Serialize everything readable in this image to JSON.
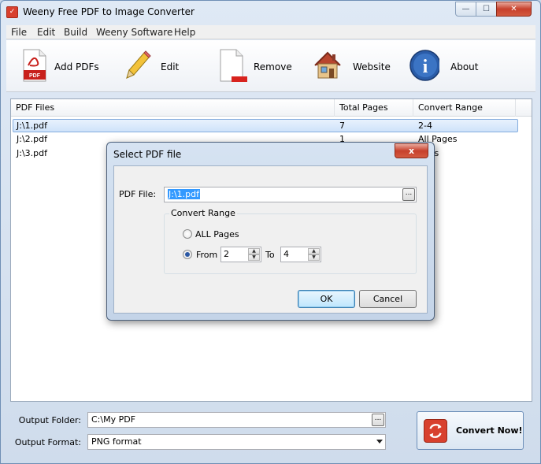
{
  "window": {
    "title": "Weeny Free PDF to Image Converter"
  },
  "menu": [
    "File",
    "Edit",
    "Build",
    "Weeny Software",
    "Help"
  ],
  "toolbar": {
    "add": "Add PDFs",
    "edit": "Edit",
    "remove": "Remove",
    "website": "Website",
    "about": "About"
  },
  "list": {
    "headers": [
      "PDF Files",
      "Total Pages",
      "Convert Range"
    ],
    "rows": [
      {
        "file": "J:\\1.pdf",
        "pages": "7",
        "range": "2-4"
      },
      {
        "file": "J:\\2.pdf",
        "pages": "1",
        "range": "All Pages"
      },
      {
        "file": "J:\\3.pdf",
        "pages": "",
        "range": "All Pages"
      }
    ],
    "visible_row3_range": "ages"
  },
  "output": {
    "folder_label": "Output Folder:",
    "folder_value": "C:\\My PDF",
    "format_label": "Output Format:",
    "format_value": "PNG format",
    "convert_label": "Convert Now!"
  },
  "dialog": {
    "title": "Select PDF file",
    "close": "x",
    "pdf_label": "PDF File:",
    "pdf_value": "J:\\1.pdf",
    "browse": "...",
    "group_title": "Convert Range",
    "all_pages": "ALL Pages",
    "from_label": "From",
    "from_value": "2",
    "to_label": "To",
    "to_value": "4",
    "ok": "OK",
    "cancel": "Cancel"
  },
  "browse_glyph": "...",
  "colors": {
    "accent": "#3399ff",
    "close": "#c7402c",
    "selection": "#cfe3fa"
  }
}
